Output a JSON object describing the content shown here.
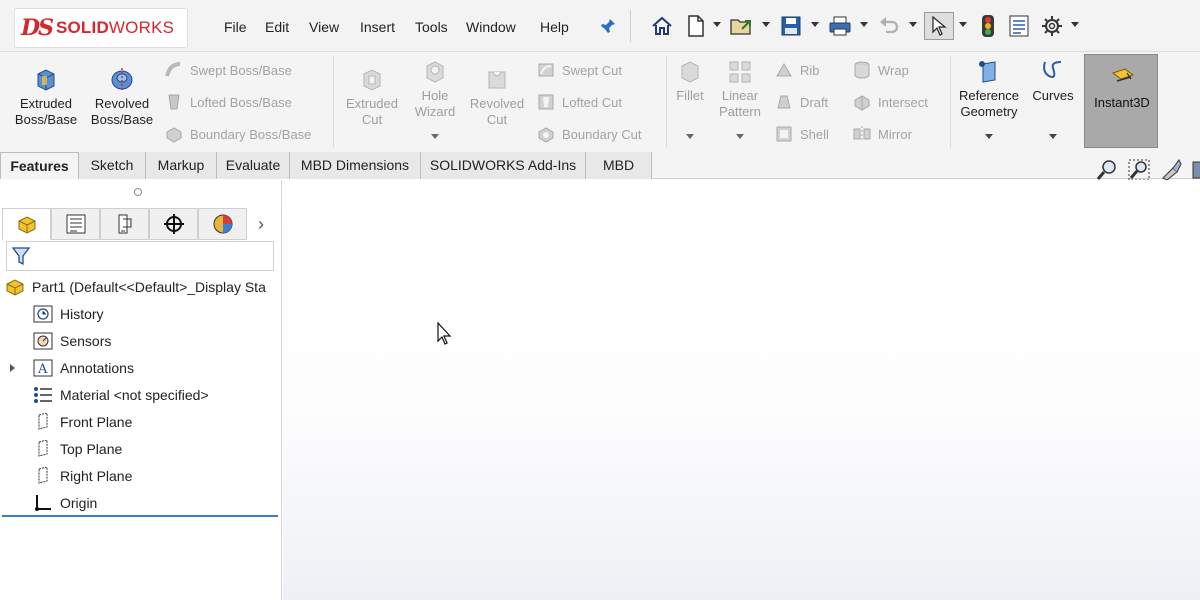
{
  "app": {
    "logo_ds": "DS",
    "logo_solid": "SOLID",
    "logo_works": "WORKS",
    "brand_color": "#d8262e"
  },
  "menu": [
    "File",
    "Edit",
    "View",
    "Insert",
    "Tools",
    "Window",
    "Help"
  ],
  "quick_access_icons": [
    "home-icon",
    "new-document-icon",
    "open-icon",
    "save-icon",
    "print-icon",
    "undo-icon",
    "select-icon",
    "rebuild-icon",
    "file-properties-icon",
    "options-icon"
  ],
  "command_manager": {
    "extruded_boss": "Extruded\nBoss/Base",
    "revolved_boss": "Revolved\nBoss/Base",
    "swept_boss": "Swept Boss/Base",
    "lofted_boss": "Lofted Boss/Base",
    "boundary_boss": "Boundary Boss/Base",
    "extruded_cut": "Extruded\nCut",
    "hole_wizard": "Hole\nWizard",
    "revolved_cut": "Revolved\nCut",
    "swept_cut": "Swept Cut",
    "lofted_cut": "Lofted Cut",
    "boundary_cut": "Boundary Cut",
    "fillet": "Fillet",
    "linear_pattern": "Linear\nPattern",
    "rib": "Rib",
    "draft": "Draft",
    "shell": "Shell",
    "wrap": "Wrap",
    "intersect": "Intersect",
    "mirror": "Mirror",
    "reference_geometry": "Reference\nGeometry",
    "curves": "Curves",
    "instant3d": "Instant3D"
  },
  "tabs": [
    "Features",
    "Sketch",
    "Markup",
    "Evaluate",
    "MBD Dimensions",
    "SOLIDWORKS Add-Ins",
    "MBD"
  ],
  "active_tab": "Features",
  "feature_tree": {
    "part": "Part1  (Default<<Default>_Display Sta",
    "items": [
      "History",
      "Sensors",
      "Annotations",
      "Material <not specified>",
      "Front Plane",
      "Top Plane",
      "Right Plane",
      "Origin"
    ]
  }
}
